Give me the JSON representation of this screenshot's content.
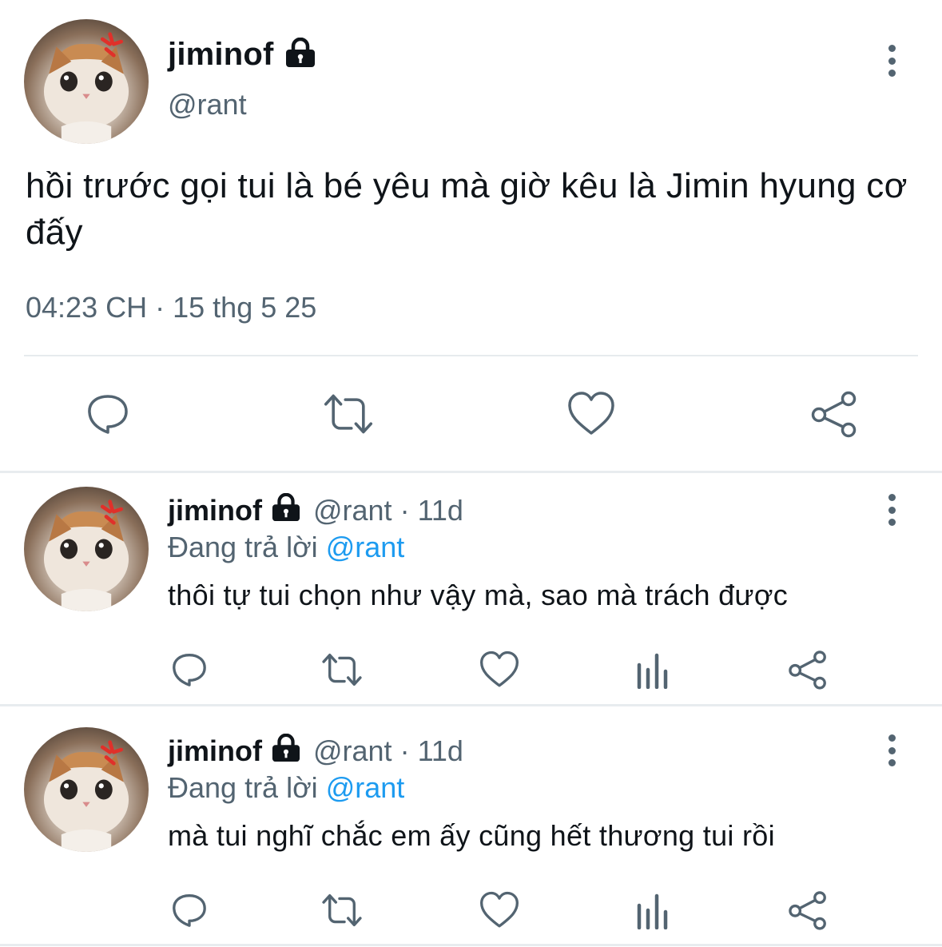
{
  "main_tweet": {
    "display_name": "jiminof",
    "handle": "@rant",
    "text": "hồi trước gọi tui là bé yêu mà giờ kêu là Jimin hyung cơ đấy",
    "time": "04:23 CH",
    "separator": "·",
    "date": "15 thg 5 25",
    "actions": [
      "reply-icon",
      "retweet-icon",
      "like-icon",
      "share-icon"
    ]
  },
  "replies": [
    {
      "display_name": "jiminof",
      "handle": "@rant",
      "separator": "·",
      "age": "11d",
      "replying_prefix": "Đang trả lời",
      "replying_to": "@rant",
      "text": "thôi tự tui chọn như vậy mà, sao mà trách được",
      "actions": [
        "reply-icon",
        "retweet-icon",
        "like-icon",
        "views-icon",
        "share-icon"
      ]
    },
    {
      "display_name": "jiminof",
      "handle": "@rant",
      "separator": "·",
      "age": "11d",
      "replying_prefix": "Đang trả lời",
      "replying_to": "@rant",
      "text": "mà tui nghĩ chắc em ấy cũng hết thương tui rồi",
      "actions": [
        "reply-icon",
        "retweet-icon",
        "like-icon",
        "views-icon",
        "share-icon"
      ]
    }
  ],
  "colors": {
    "text_primary": "#0f1419",
    "text_secondary": "#536471",
    "accent": "#1d9bf0",
    "divider": "#e8ecef"
  }
}
